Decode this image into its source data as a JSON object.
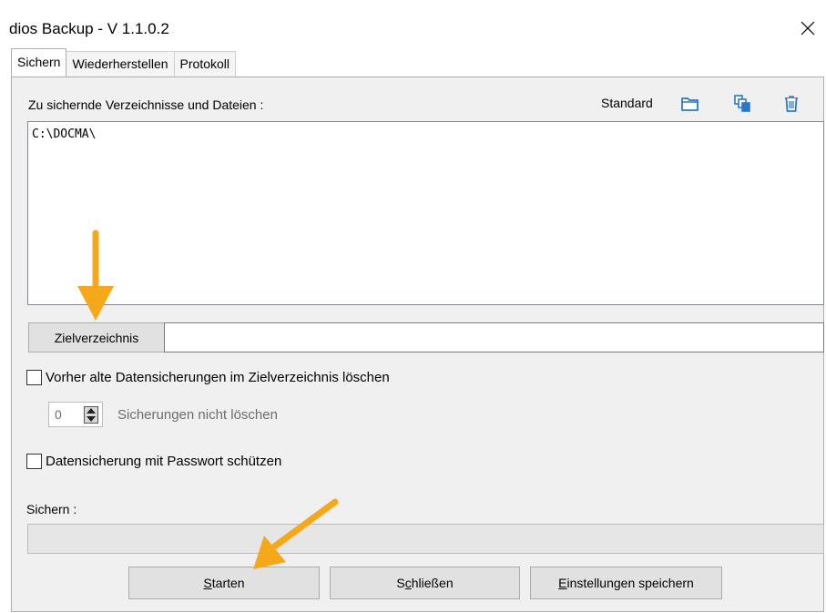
{
  "window": {
    "title": "dios Backup - V 1.1.0.2"
  },
  "tabs": [
    {
      "label": "Sichern",
      "active": true
    },
    {
      "label": "Wiederherstellen",
      "active": false
    },
    {
      "label": "Protokoll",
      "active": false
    }
  ],
  "files": {
    "label": "Zu sichernde Verzeichnisse und Dateien :",
    "standard_label": "Standard",
    "icons": [
      "folder-open-icon",
      "copy-icon",
      "trash-icon"
    ],
    "entries": [
      "C:\\DOCMA\\"
    ]
  },
  "target": {
    "button_label": "Zielverzeichnis",
    "value": ""
  },
  "delete_old": {
    "label": "Vorher alte Datensicherungen im Zielverzeichnis löschen",
    "checked": false
  },
  "keep": {
    "value": "0",
    "label": "Sicherungen nicht löschen"
  },
  "password": {
    "label": "Datensicherung mit Passwort schützen",
    "checked": false
  },
  "progress": {
    "label": "Sichern :",
    "value": 0
  },
  "actions": {
    "start": {
      "mnemonic": "S",
      "rest": "tarten"
    },
    "close": {
      "pre": "S",
      "mnemonic": "c",
      "rest": "hließen"
    },
    "save": {
      "mnemonic": "E",
      "rest": "instellungen speichern"
    }
  },
  "colors": {
    "annotation_arrow": "#F5A81C",
    "icon_blue": "#2B78C5"
  }
}
